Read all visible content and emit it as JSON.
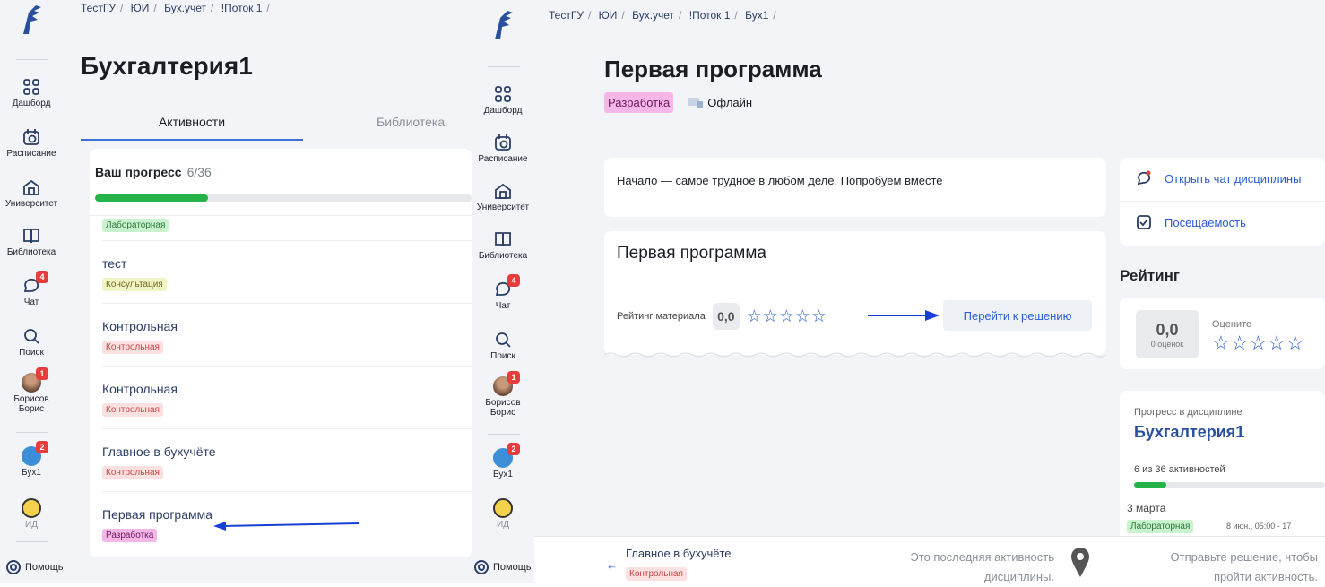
{
  "left": {
    "breadcrumbs": [
      "ТестГУ",
      "ЮИ",
      "Бух.учет",
      "!Поток 1"
    ],
    "title": "Бухгалтерия1",
    "tabs": [
      "Активности",
      "Библиотека"
    ],
    "progress": {
      "label": "Ваш прогресс",
      "count": "6/36",
      "fraction": 0.3
    },
    "activities": [
      {
        "title": "",
        "tag": "Лабораторная",
        "tag_type": "lab"
      },
      {
        "title": "тест",
        "tag": "Консультация",
        "tag_type": "cons"
      },
      {
        "title": "Контрольная",
        "tag": "Контрольная",
        "tag_type": "ctrl"
      },
      {
        "title": "Контрольная",
        "tag": "Контрольная",
        "tag_type": "ctrl"
      },
      {
        "title": "Главное в бухучёте",
        "tag": "Контрольная",
        "tag_type": "ctrl"
      },
      {
        "title": "Первая программа",
        "tag": "Разработка",
        "tag_type": "dev"
      }
    ]
  },
  "sidebar": {
    "items": [
      {
        "label": "Дашборд",
        "icon": "dashboard-icon"
      },
      {
        "label": "Расписание",
        "icon": "calendar-icon"
      },
      {
        "label": "Университет",
        "icon": "university-icon"
      },
      {
        "label": "Библиотека",
        "icon": "book-icon"
      },
      {
        "label": "Чат",
        "icon": "chat-icon",
        "badge": "4"
      },
      {
        "label": "Поиск",
        "icon": "search-icon"
      },
      {
        "label": "Борисов Борис",
        "icon": "avatar",
        "badge": "1"
      },
      {
        "label": "Бух1",
        "icon": "course-icon",
        "badge": "2"
      },
      {
        "label": "ИД",
        "icon": "demo-icon"
      }
    ],
    "help": "Помощь"
  },
  "right": {
    "breadcrumbs": [
      "ТестГУ",
      "ЮИ",
      "Бух.учет",
      "!Поток 1",
      "Бух1"
    ],
    "title": "Первая программа",
    "tag": "Разработка",
    "mode": "Офлайн",
    "intro": "Начало — самое трудное в любом деле. Попробуем вместе",
    "material": {
      "title": "Первая программа",
      "rating_label": "Рейтинг материала",
      "rating_value": "0,0",
      "stars": "☆☆☆☆☆",
      "go_button": "Перейти к решению"
    },
    "side": {
      "chat": "Открыть чат дисциплины",
      "attendance": "Посещаемость",
      "rating_title": "Рейтинг",
      "rating_value": "0,0",
      "rating_count": "0 оценок",
      "rate_label": "Оцените",
      "stars": "☆☆☆☆☆",
      "progress_label": "Прогресс в дисциплине",
      "progress_course": "Бухгалтерия1",
      "progress_text": "6 из 36 активностей",
      "progress_fraction": 0.17,
      "next_date": "3 марта",
      "next_tag": "Лабораторная",
      "next_time": "8 июн., 05:00 - 17"
    },
    "footer": {
      "prev_title": "Главное в бухучёте",
      "prev_tag": "Контрольная",
      "last_text_1": "Это последняя активность",
      "last_text_2": "дисциплины.",
      "submit_text_1": "Отправьте решение, чтобы",
      "submit_text_2": "пройти активность."
    }
  },
  "colors": {
    "accent": "#2a5bd7",
    "progress": "#25b34a",
    "tab_underline": "#3d6fd8",
    "arrow": "#1a3fd6"
  }
}
